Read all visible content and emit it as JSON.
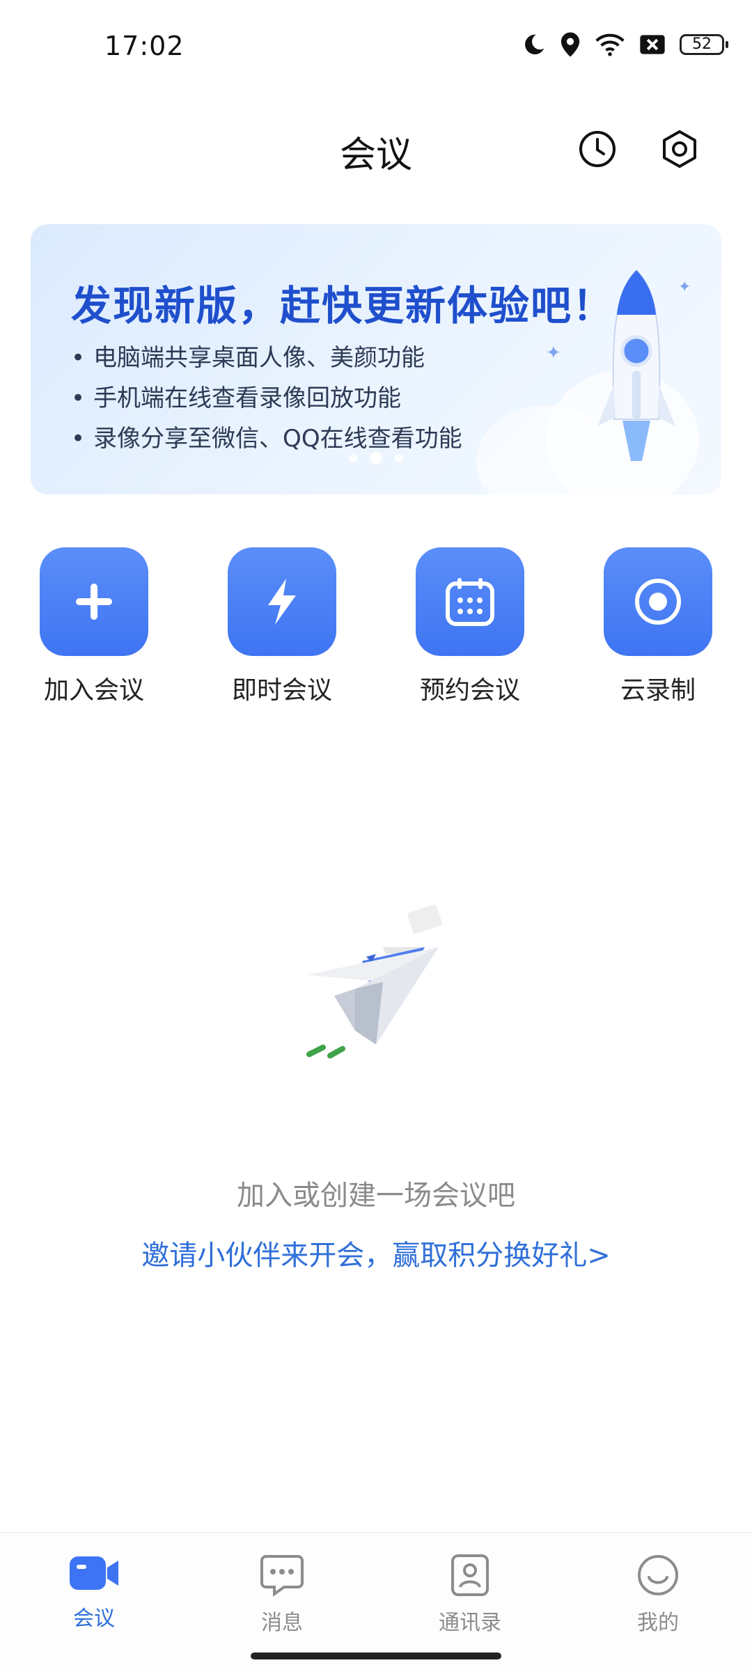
{
  "status_bar": {
    "time": "17:02",
    "battery": "52"
  },
  "header": {
    "title": "会议",
    "history_icon": "clock-icon",
    "settings_icon": "hexagon-settings-icon"
  },
  "banner": {
    "title": "发现新版，赶快更新体验吧！",
    "bullets": [
      "电脑端共享桌面人像、美颜功能",
      "手机端在线查看录像回放功能",
      "录像分享至微信、QQ在线查看功能"
    ],
    "slides": 3,
    "active_slide": 2
  },
  "actions": [
    {
      "label": "加入会议",
      "icon": "plus-icon"
    },
    {
      "label": "即时会议",
      "icon": "lightning-icon"
    },
    {
      "label": "预约会议",
      "icon": "calendar-icon"
    },
    {
      "label": "云录制",
      "icon": "record-icon"
    }
  ],
  "empty_state": {
    "illustration": "paper-plane-illustration",
    "message": "加入或创建一场会议吧",
    "invite_link": "邀请小伙伴来开会，赢取积分换好礼>"
  },
  "bottom_nav": {
    "items": [
      {
        "label": "会议",
        "icon": "video-camera-icon",
        "active": true
      },
      {
        "label": "消息",
        "icon": "chat-bubble-icon",
        "active": false
      },
      {
        "label": "通讯录",
        "icon": "contact-card-icon",
        "active": false
      },
      {
        "label": "我的",
        "icon": "smiley-icon",
        "active": false
      }
    ]
  },
  "colors": {
    "accent": "#3e74f3",
    "link": "#2f6fd9",
    "banner_title": "#1f4fcc"
  }
}
